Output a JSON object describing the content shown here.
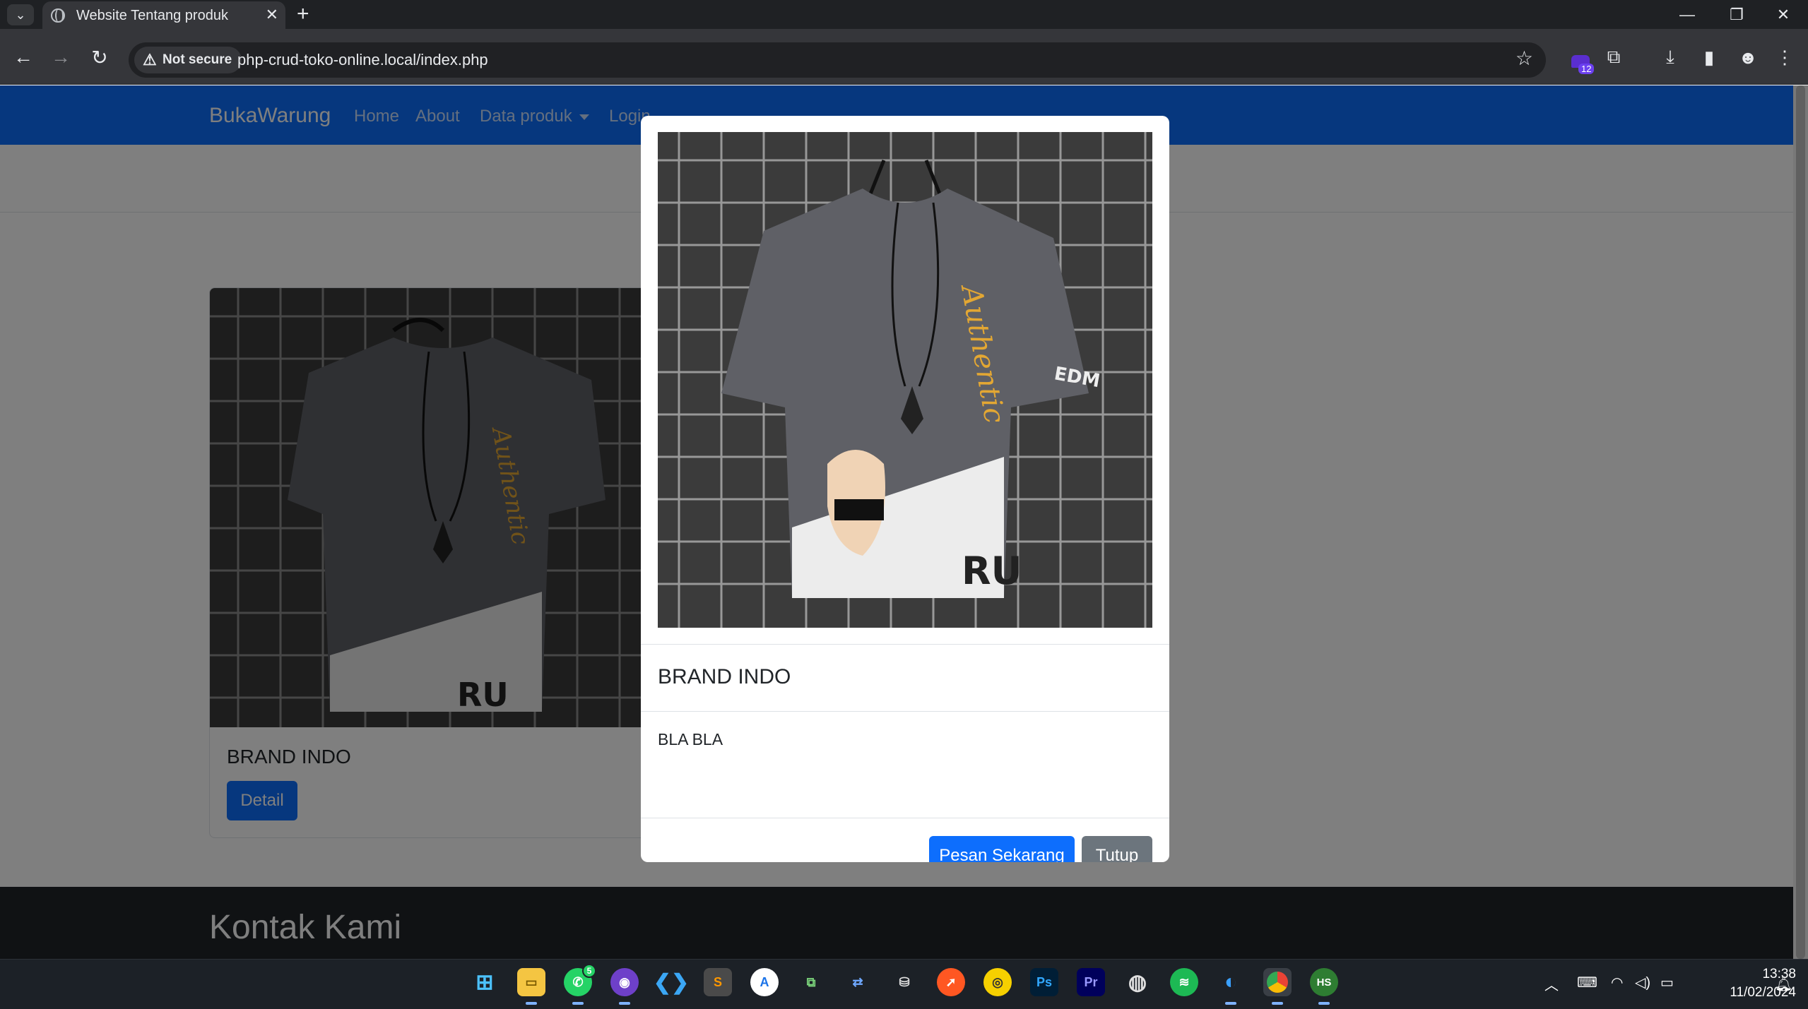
{
  "browser": {
    "tab_title": "Website Tentang produk",
    "security_label": "Not secure",
    "url": "php-crud-toko-online.local/index.php",
    "extension_badge_count": "12"
  },
  "site": {
    "brand": "BukaWarung",
    "nav": {
      "home": "Home",
      "about": "About",
      "data_produk": "Data produk",
      "login": "Login"
    },
    "nav_color": "#0d6efd"
  },
  "product_card": {
    "title": "BRAND INDO",
    "detail_button": "Detail",
    "image_icon": "t-shirt-photo"
  },
  "footer": {
    "title": "Kontak Kami"
  },
  "modal": {
    "title": "BRAND INDO",
    "description": "BLA BLA",
    "order_button": "Pesan Sekarang",
    "close_button": "Tutup"
  },
  "taskbar": {
    "whatsapp_badge": "5",
    "time": "13:38",
    "date": "11/02/2024"
  }
}
